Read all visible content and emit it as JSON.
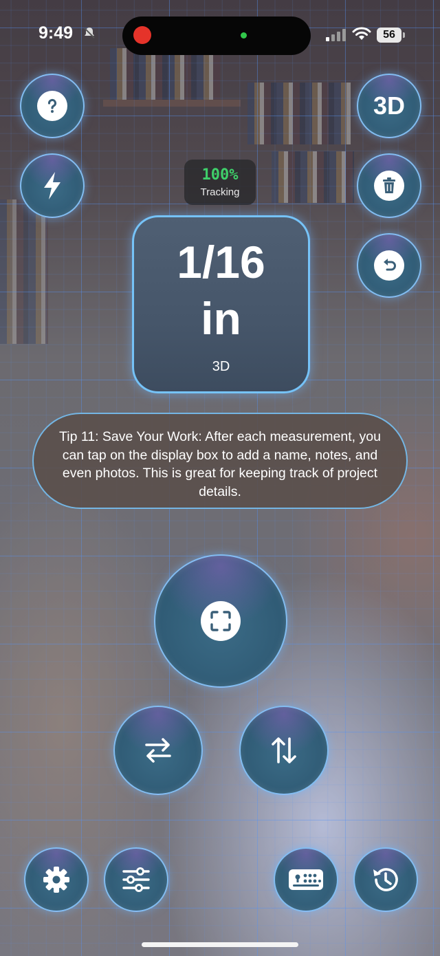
{
  "status_bar": {
    "time": "9:49",
    "battery": "56"
  },
  "tracking": {
    "percent": "100%",
    "label": "Tracking"
  },
  "measurement": {
    "value": "1/16\nin",
    "mode": "3D"
  },
  "tip": {
    "text": "Tip 11: Save Your Work: After each measurement, you can tap on the display box to add a name, notes, and even photos. This is great for keeping track of project details."
  },
  "buttons": {
    "view_3d": "3D"
  },
  "icons": {
    "help": "question-icon",
    "flash": "bolt-icon",
    "delete": "trash-icon",
    "undo": "undo-icon",
    "capture": "viewfinder-icon",
    "swap_horizontal": "arrows-horizontal-icon",
    "swap_vertical": "arrows-vertical-icon",
    "settings": "gear-icon",
    "adjust": "sliders-icon",
    "keypad": "keypad-icon",
    "history": "history-icon"
  },
  "colors": {
    "accent_border": "#78c8ff",
    "tracking_green": "#3fd06a",
    "record_red": "#e5332a"
  }
}
